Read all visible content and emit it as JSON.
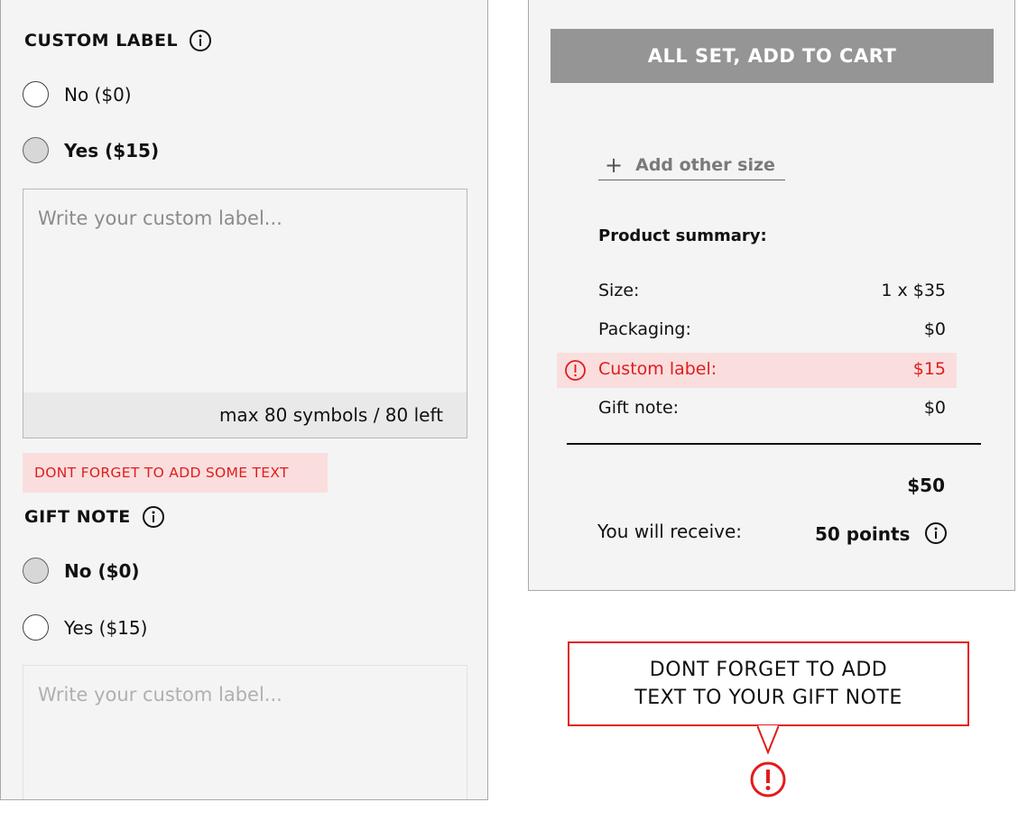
{
  "custom_label": {
    "heading": "CUSTOM LABEL",
    "option_no": "No ($0)",
    "option_yes": "Yes ($15)",
    "placeholder": "Write your custom label...",
    "counter": "max 80 symbols / 80 left",
    "error": "DONT FORGET TO ADD SOME TEXT"
  },
  "gift_note": {
    "heading": "GIFT NOTE",
    "option_no": "No ($0)",
    "option_yes": "Yes ($15)",
    "placeholder": "Write your custom label..."
  },
  "cart": {
    "button_label": "ALL SET, ADD TO CART",
    "add_size_label": "Add other size"
  },
  "summary": {
    "title": "Product summary:",
    "rows": [
      {
        "label": "Size:",
        "value": "1 x $35"
      },
      {
        "label": "Packaging:",
        "value": "$0"
      },
      {
        "label": "Custom label:",
        "value": "$15"
      },
      {
        "label": "Gift note:",
        "value": "$0"
      }
    ],
    "total": "$50",
    "receive_label": "You will receive:",
    "points": "50 points"
  },
  "callout": {
    "line1": "DONT FORGET TO ADD",
    "line2": "TEXT TO YOUR GIFT NOTE"
  },
  "colors": {
    "error": "#e21c1c",
    "error_bg": "#fadede",
    "panel_bg": "#f4f4f4",
    "button_bg": "#959595"
  },
  "icons": {
    "info": "info-circle-icon",
    "plus": "plus-icon",
    "alert": "exclamation-circle-icon"
  }
}
